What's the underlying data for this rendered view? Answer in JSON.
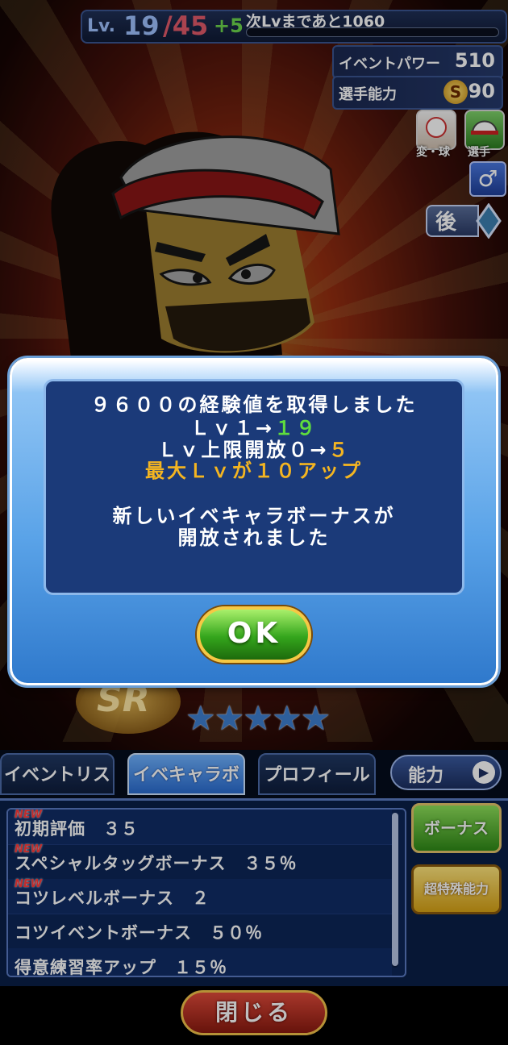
{
  "status": {
    "lv_label": "Lv.",
    "lv_current": "19",
    "lv_max": "/45",
    "lv_plus": "+5",
    "next_label": "次Lvまであと1060",
    "event_power_label": "イベントパワー",
    "event_power_value": "510",
    "player_ability_label": "選手能力",
    "rank_badge": "S",
    "player_ability_value": "90"
  },
  "side": {
    "pitch_label": "変・球",
    "player_label": "選手",
    "gender": "♂",
    "position": "後"
  },
  "card": {
    "rarity": "SR",
    "stars": "★★★★★"
  },
  "tabs": {
    "event_list": "イベントリスト",
    "evechara_bonus": "イベキャラボーナス",
    "profile": "プロフィール",
    "ability": "能力"
  },
  "bonus_list": [
    {
      "new": "NEW",
      "text": "初期評価　３５"
    },
    {
      "new": "NEW",
      "text": "スペシャルタッグボーナス　３５％"
    },
    {
      "new": "NEW",
      "text": "コツレベルボーナス　２"
    },
    {
      "new": "",
      "text": "コツイベントボーナス　５０％"
    },
    {
      "new": "",
      "text": "得意練習率アップ　１５％"
    }
  ],
  "side_buttons": {
    "bonus": "ボーナス",
    "special": "超特殊能力"
  },
  "close_label": "閉じる",
  "dialog": {
    "line1": "９６００の経験値を取得しました",
    "line2_prefix": "Ｌｖ１→",
    "line2_value": "１９",
    "line3_prefix": "Ｌｖ上限開放０→",
    "line3_value": "５",
    "line4": "最大Ｌｖが１０アップ",
    "line5": "新しいイベキャラボーナスが",
    "line6": "開放されました",
    "ok_label": "OK"
  },
  "colors": {
    "accent_green": "#5fdc3d",
    "accent_yellow": "#f4b521",
    "panel_blue": "#1b3a79"
  }
}
